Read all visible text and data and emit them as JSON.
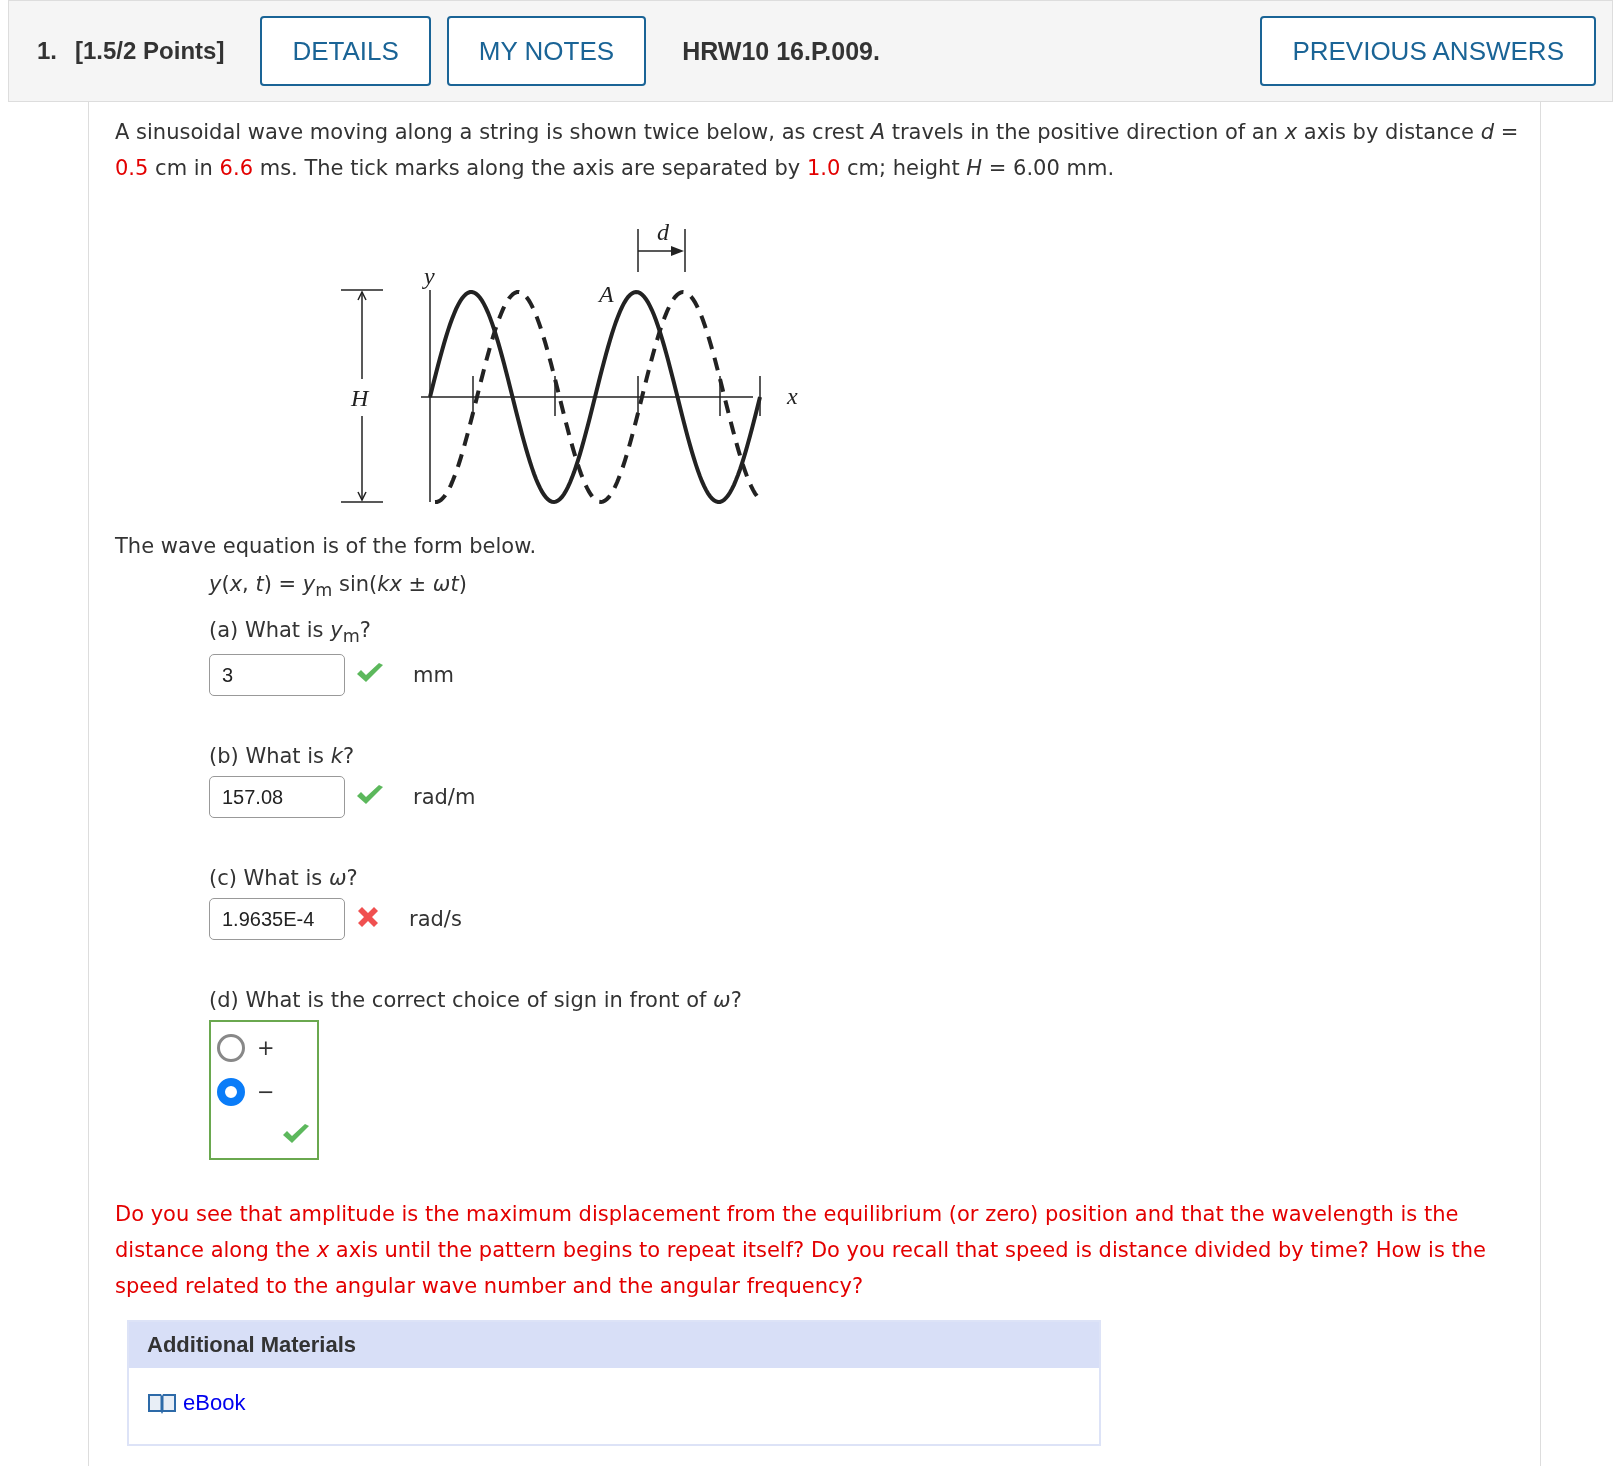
{
  "header": {
    "number": "1.",
    "points": "[1.5/2 Points]",
    "buttons": [
      "DETAILS",
      "MY NOTES"
    ],
    "problem_id": "HRW10 16.P.009.",
    "previous_button": "PREVIOUS ANSWERS"
  },
  "intro": [
    {
      "kind": "text",
      "text": "A sinusoidal wave moving along a string is shown twice below, as crest "
    },
    {
      "kind": "var",
      "text": "A"
    },
    {
      "kind": "text",
      "text": " travels in the positive direction of an "
    },
    {
      "kind": "var",
      "text": "x"
    },
    {
      "kind": "text",
      "text": " axis by distance "
    },
    {
      "kind": "var",
      "text": "d"
    },
    {
      "kind": "text",
      "text": " = "
    },
    {
      "kind": "value",
      "text": "0.5"
    },
    {
      "kind": "text",
      "text": " cm in "
    },
    {
      "kind": "value",
      "text": "6.6"
    },
    {
      "kind": "text",
      "text": " ms. The tick marks along the axis are separated by "
    },
    {
      "kind": "value",
      "text": "1.0"
    },
    {
      "kind": "text",
      "text": " cm; height  "
    },
    {
      "kind": "var",
      "text": "H"
    },
    {
      "kind": "text",
      "text": " = 6.00 mm."
    }
  ],
  "figure": {
    "labels": {
      "y": "y",
      "x": "x",
      "A": "A",
      "d": "d",
      "H": "H"
    }
  },
  "form_text": "The wave equation is of the form below.",
  "equation": "*y*(*x*, *t*) = *y*$_{m}$ sin(*kx* ± *ωt*)",
  "questions": [
    {
      "kind": "numeric",
      "label": "(a) What is *y*$_{m}$?",
      "value": "3",
      "correct": true,
      "unit": "mm"
    },
    {
      "kind": "numeric",
      "label": "(b) What is *k*?",
      "value": "157.08",
      "correct": true,
      "unit": "rad/m"
    },
    {
      "kind": "numeric",
      "label": "(c) What is *ω*?",
      "value": "1.9635E-4",
      "correct": false,
      "unit": "rad/s"
    },
    {
      "kind": "choice",
      "label": "(d) What is the correct choice of sign in front of *ω*?",
      "correct": true,
      "options": [
        {
          "label": "+",
          "selected": false
        },
        {
          "label": "−",
          "selected": true
        }
      ]
    }
  ],
  "hint": "Do you see that amplitude is the maximum displacement from the equilibrium (or zero) position and that the wavelength is the distance along the *x* axis until the pattern begins to repeat itself? Do you recall that speed is distance divided by time? How is the speed related to the angular wave number and the angular frequency?",
  "additional_materials": {
    "title": "Additional Materials",
    "links": [
      "eBook"
    ]
  }
}
